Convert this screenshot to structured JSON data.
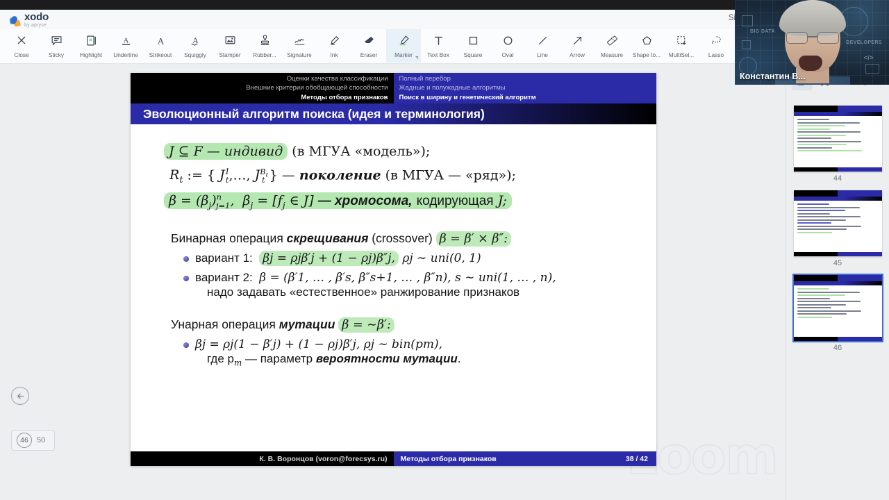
{
  "app": {
    "brand_name": "xodo",
    "brand_sub": "by apryse",
    "signin_label": "Sign in"
  },
  "toolbar": {
    "tools": [
      {
        "label": "Close",
        "icon": "close-icon"
      },
      {
        "label": "Sticky",
        "icon": "sticky-note-icon"
      },
      {
        "label": "Highlight",
        "icon": "highlight-icon"
      },
      {
        "label": "Underline",
        "icon": "underline-icon"
      },
      {
        "label": "Strikeout",
        "icon": "strikeout-icon"
      },
      {
        "label": "Squiggly",
        "icon": "squiggly-icon"
      },
      {
        "label": "Stamper",
        "icon": "stamper-icon"
      },
      {
        "label": "Rubber...",
        "icon": "rubber-stamp-icon"
      },
      {
        "label": "Signature",
        "icon": "signature-icon"
      },
      {
        "label": "Ink",
        "icon": "ink-pen-icon"
      },
      {
        "label": "Eraser",
        "icon": "eraser-icon"
      },
      {
        "label": "Marker",
        "icon": "marker-icon",
        "selected": true
      },
      {
        "label": "Text Box",
        "icon": "text-box-icon"
      },
      {
        "label": "Square",
        "icon": "square-icon"
      },
      {
        "label": "Oval",
        "icon": "oval-icon"
      },
      {
        "label": "Line",
        "icon": "line-icon"
      },
      {
        "label": "Arrow",
        "icon": "arrow-icon"
      },
      {
        "label": "Measure",
        "icon": "ruler-icon"
      },
      {
        "label": "Shape to...",
        "icon": "pentagon-icon"
      },
      {
        "label": "MultiSel...",
        "icon": "multiselect-icon"
      },
      {
        "label": "Lasso",
        "icon": "lasso-icon"
      }
    ]
  },
  "viewer": {
    "back_icon": "back-arrow-icon",
    "current_page": "46",
    "total_pages": "50",
    "watermark": "zoom"
  },
  "slide": {
    "nav_left": [
      "Оценки качества классификации",
      "Внешние критерии обобщающей способности",
      "Методы отбора признаков"
    ],
    "nav_right": [
      "Полный перебор",
      "Жадные и полужадные алгоритмы",
      "Поиск в ширину и генетический алгоритм"
    ],
    "title": "Эволюционный алгоритм поиска (идея и терминология)",
    "line1_highlight": "J ⊆ F — индивид",
    "line1_rest": " (в МГУА «модель»);",
    "line2_math": "R",
    "line2_sub": "t",
    "line2_mid": " := { J",
    "line2_rest": " } — поколение (в МГУА — «ряд»);",
    "line3_a": "β = (β",
    "line3_b": "β",
    "line3_c": " — хромосома, кодирующая J;",
    "crossover_prefix": "Бинарная операция ",
    "crossover_it": "скрещивания",
    "crossover_mid": " (crossover) ",
    "crossover_formula": "β = β′ × β″:",
    "variant1_label": "вариант 1:",
    "variant1_formula_hl": "βj = ρjβ′j + (1 − ρj)β″j,",
    "variant1_formula_tail": " ρj ∼ uni(0, 1)",
    "variant2_label": "вариант 2:",
    "variant2_formula": "β = (β′1, … , β′s, β″s+1, … , β″n),  s ∼ uni(1, … , n),",
    "variant2_sub": "надо задавать «естественное» ранжирование признаков",
    "mutation_prefix": "Унарная операция ",
    "mutation_it": "мутации",
    "mutation_formula": "β = ∼β′:",
    "mutation_bullet": "βj = ρj(1 − β′j) + (1 − ρj)β′j,  ρj ∼ bin(pm),",
    "mutation_sub_a": "где p",
    "mutation_sub_b": "m",
    "mutation_sub_c": " — параметр ",
    "mutation_sub_it": "вероятности мутации",
    "mutation_sub_d": ".",
    "footer_author": "К. В. Воронцов (voron@forecsys.ru)",
    "footer_section": "Методы отбора признаков",
    "footer_page": "38 / 42"
  },
  "rail": {
    "tabs": [
      {
        "icon": "thumbnails-icon",
        "selected": true
      },
      {
        "icon": "bookmark-icon",
        "selected": false
      },
      {
        "icon": "outline-list-icon",
        "selected": false
      },
      {
        "icon": "comments-icon",
        "selected": false
      }
    ],
    "thumbnails": [
      {
        "number": "44",
        "current": false
      },
      {
        "number": "45",
        "current": false
      },
      {
        "number": "46",
        "current": true
      }
    ]
  },
  "video": {
    "participant_name": "Константин В...",
    "bg_labels": [
      "BIG DATA",
      "DEVELOPERS",
      "</>"
    ]
  }
}
